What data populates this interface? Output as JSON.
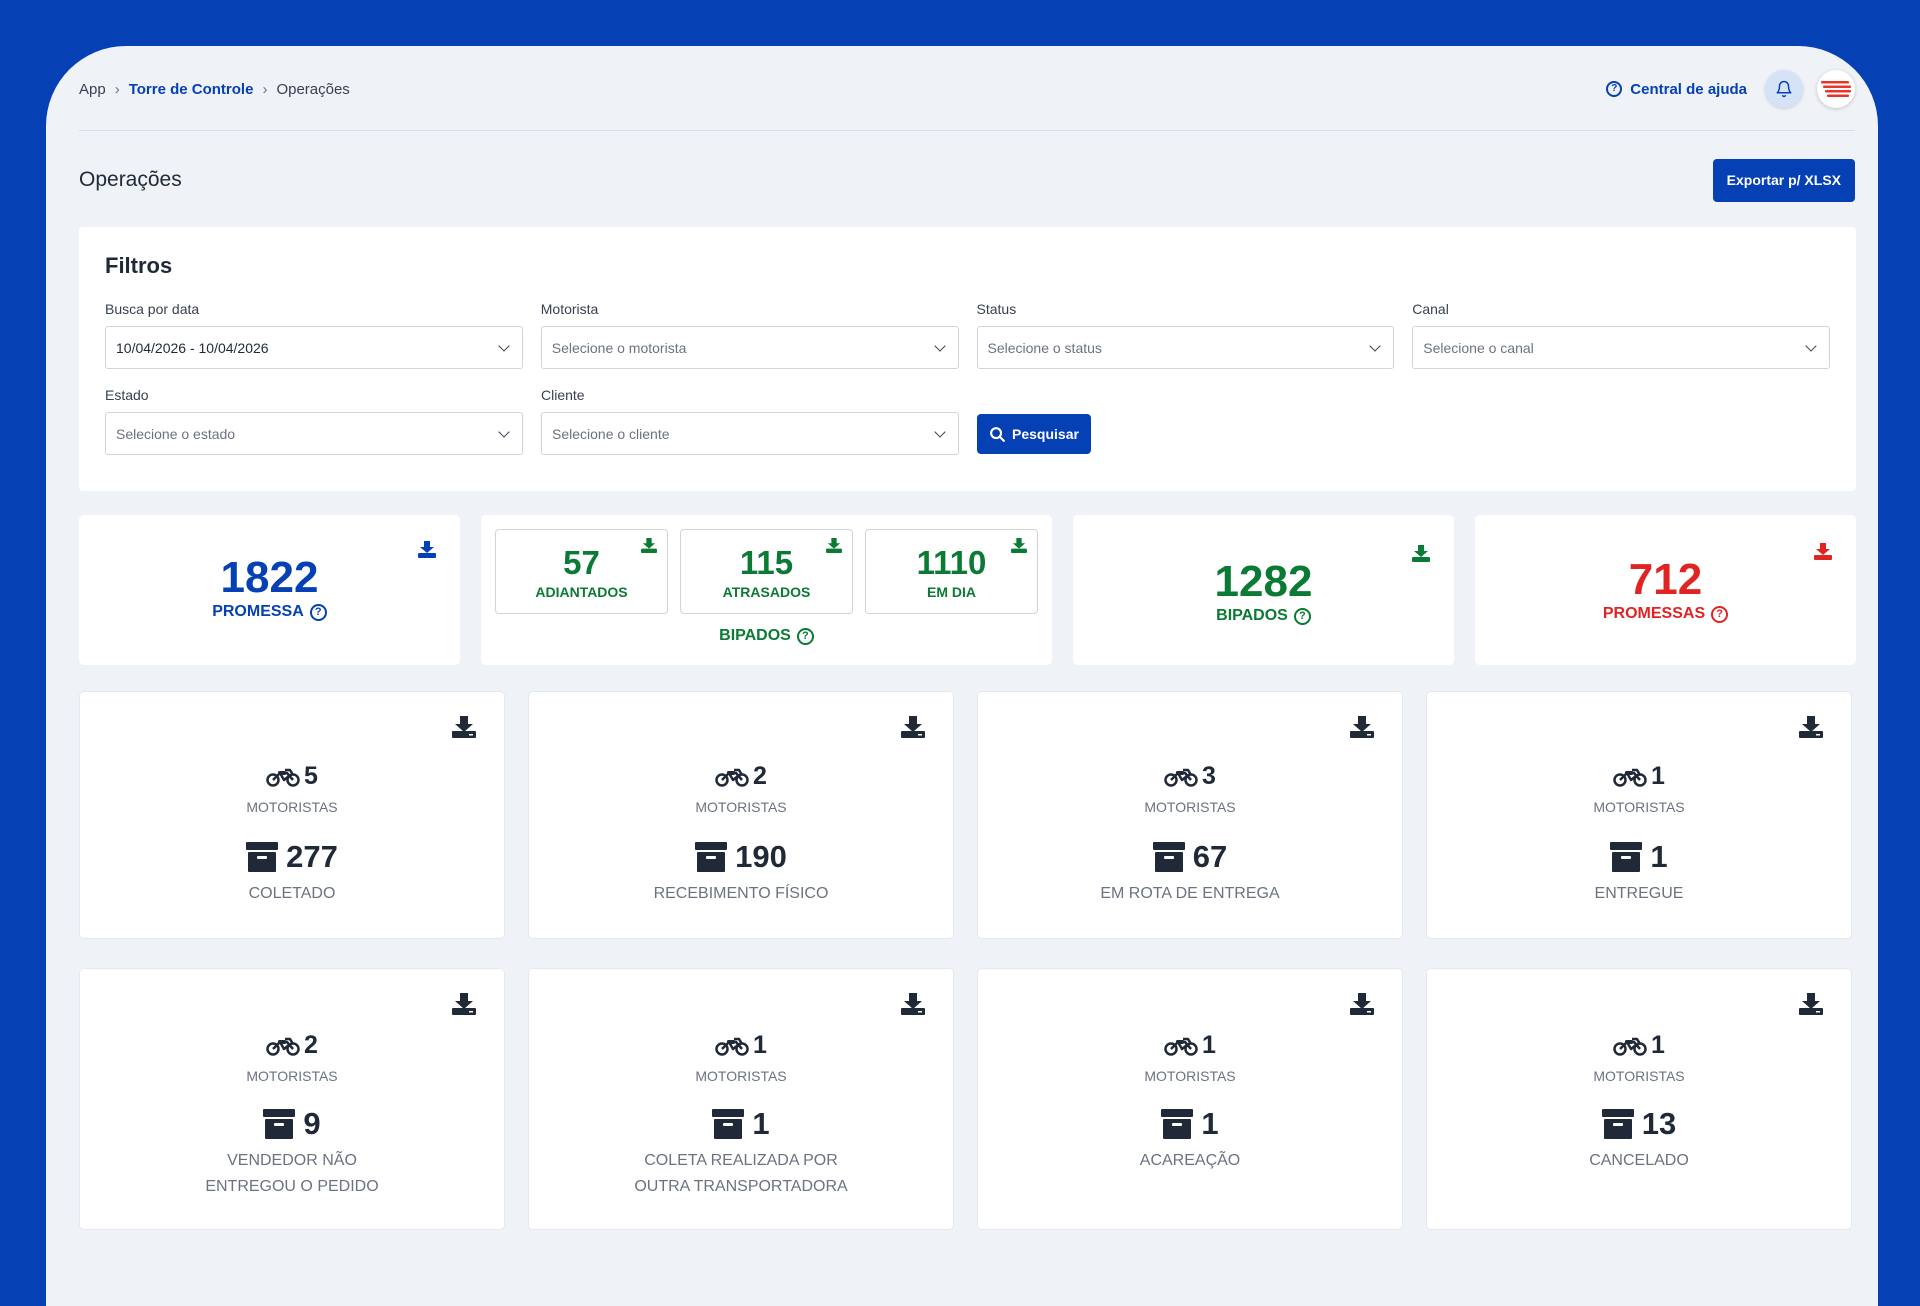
{
  "breadcrumb": {
    "root": "App",
    "section": "Torre de Controle",
    "current": "Operações"
  },
  "header": {
    "help_label": "Central de ajuda"
  },
  "page": {
    "title": "Operações",
    "export_label": "Exportar p/ XLSX"
  },
  "filters": {
    "title": "Filtros",
    "date": {
      "label": "Busca por data",
      "value": "10/04/2026 - 10/04/2026"
    },
    "driver": {
      "label": "Motorista",
      "placeholder": "Selecione o motorista"
    },
    "status": {
      "label": "Status",
      "placeholder": "Selecione o status"
    },
    "channel": {
      "label": "Canal",
      "placeholder": "Selecione o canal"
    },
    "state": {
      "label": "Estado",
      "placeholder": "Selecione o estado"
    },
    "client": {
      "label": "Cliente",
      "placeholder": "Selecione o cliente"
    },
    "search_label": "Pesquisar"
  },
  "kpis": {
    "promise": {
      "value": "1822",
      "label": "PROMESSA"
    },
    "scanned_breakdown": {
      "early": {
        "value": "57",
        "label": "ADIANTADOS"
      },
      "late": {
        "value": "115",
        "label": "ATRASADOS"
      },
      "on_time": {
        "value": "1110",
        "label": "EM DIA"
      },
      "label": "BIPADOS"
    },
    "scanned": {
      "value": "1282",
      "label": "BIPADOS"
    },
    "pending": {
      "value": "712",
      "label": "PROMESSAS"
    }
  },
  "colors": {
    "brand_blue": "#0640B5",
    "green": "#0A7A34",
    "red": "#E02424"
  },
  "cards": [
    {
      "drivers": "5",
      "drivers_label": "MOTORISTAS",
      "count": "277",
      "status_line1": "COLETADO",
      "status_line2": ""
    },
    {
      "drivers": "2",
      "drivers_label": "MOTORISTAS",
      "count": "190",
      "status_line1": "RECEBIMENTO FÍSICO",
      "status_line2": ""
    },
    {
      "drivers": "3",
      "drivers_label": "MOTORISTAS",
      "count": "67",
      "status_line1": "EM ROTA DE ENTREGA",
      "status_line2": ""
    },
    {
      "drivers": "1",
      "drivers_label": "MOTORISTAS",
      "count": "1",
      "status_line1": "ENTREGUE",
      "status_line2": ""
    },
    {
      "drivers": "2",
      "drivers_label": "MOTORISTAS",
      "count": "9",
      "status_line1": "VENDEDOR NÃO",
      "status_line2": "ENTREGOU O PEDIDO"
    },
    {
      "drivers": "1",
      "drivers_label": "MOTORISTAS",
      "count": "1",
      "status_line1": "COLETA REALIZADA POR",
      "status_line2": "OUTRA TRANSPORTADORA"
    },
    {
      "drivers": "1",
      "drivers_label": "MOTORISTAS",
      "count": "1",
      "status_line1": "ACAREAÇÃO",
      "status_line2": ""
    },
    {
      "drivers": "1",
      "drivers_label": "MOTORISTAS",
      "count": "13",
      "status_line1": "CANCELADO",
      "status_line2": ""
    }
  ]
}
